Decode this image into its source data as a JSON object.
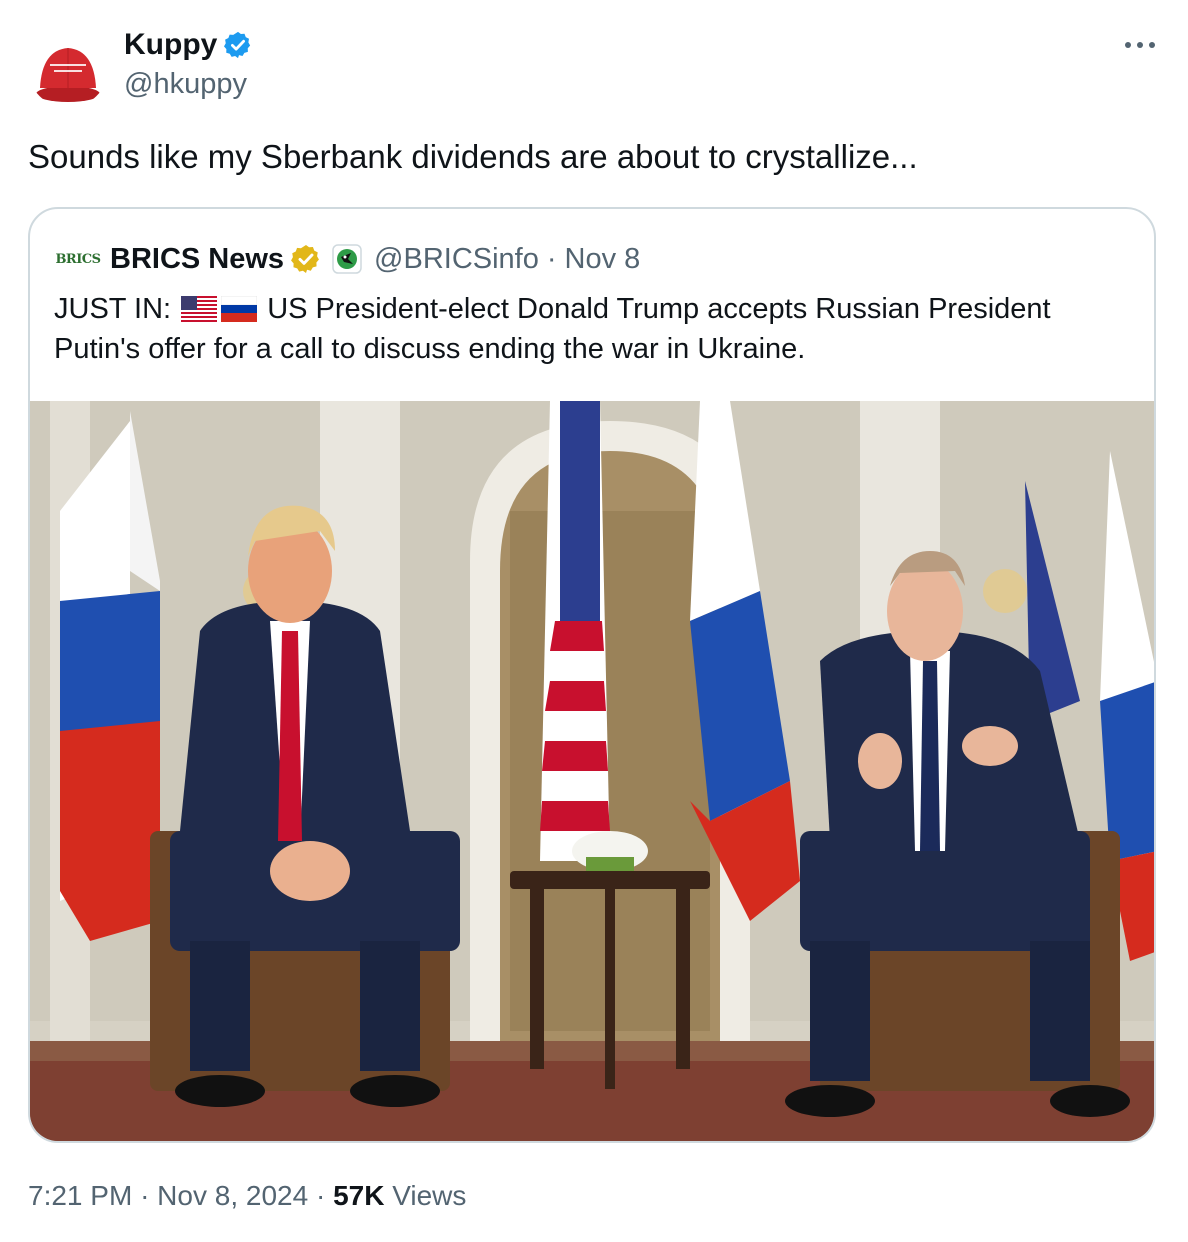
{
  "author": {
    "name": "Kuppy",
    "handle": "@hkuppy",
    "avatar_icon": "red-maga-style-cap",
    "verified": true
  },
  "tweet": {
    "text": "Sounds like my Sberbank dividends are about to crystallize..."
  },
  "quoted": {
    "logo_text": "BRICS",
    "name": "BRICS News",
    "handle": "@BRICSinfo",
    "separator": "·",
    "date": "Nov 8",
    "text_prefix": "JUST IN:",
    "text_body": "US President-elect Donald Trump accepts Russian President Putin's offer for a call to discuss ending the war in Ukraine.",
    "flags": [
      "us-flag",
      "russia-flag"
    ],
    "image_icon": "photo-trump-putin-meeting"
  },
  "meta": {
    "time": "7:21 PM",
    "date": "Nov 8, 2024",
    "sep": "·",
    "views_count": "57K",
    "views_label": "Views"
  },
  "colors": {
    "verified_blue": "#1d9bf0",
    "gold_badge": "#e2b719",
    "text_secondary": "#536471",
    "border": "#cfd9de"
  }
}
